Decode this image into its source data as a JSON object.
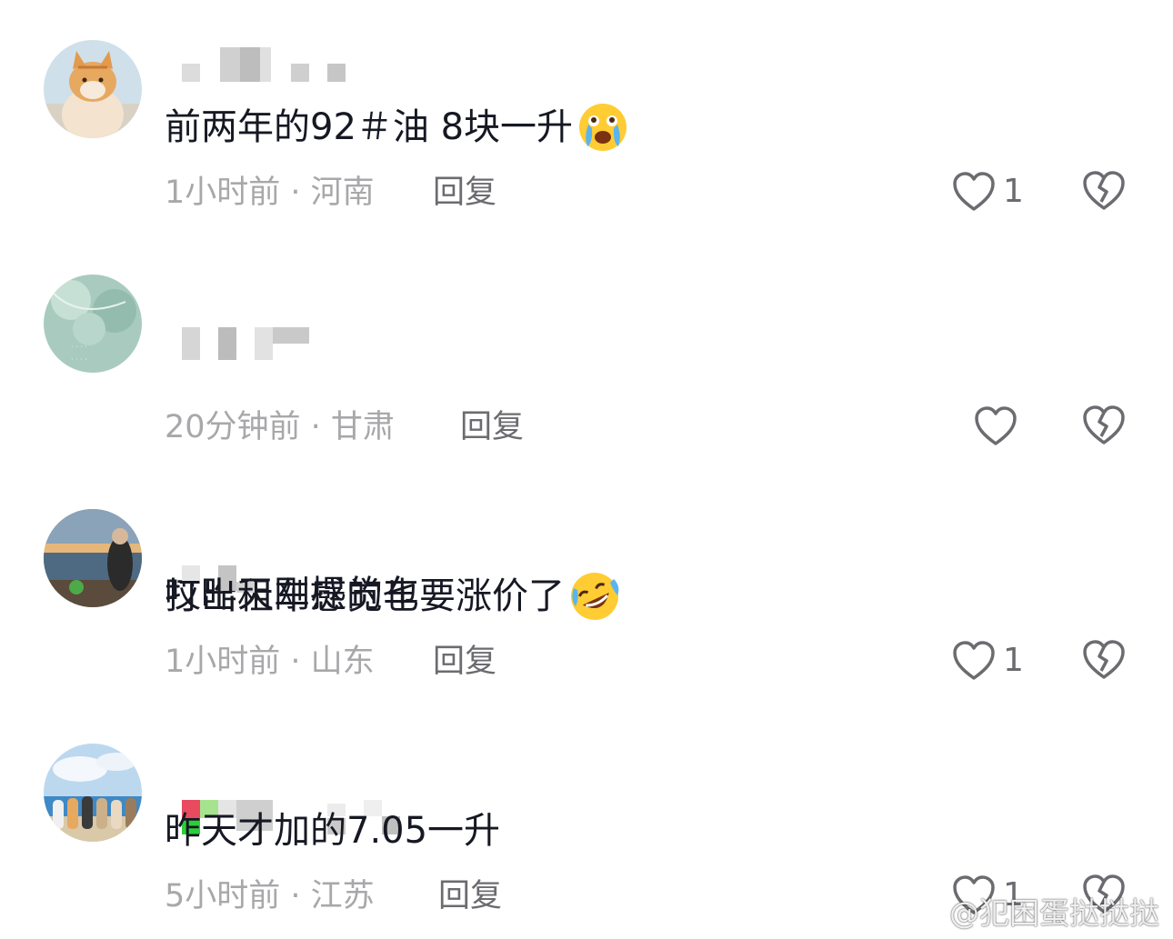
{
  "comments": [
    {
      "text": "前两年的92＃油 8块一升",
      "emoji": "crying-emoji",
      "time": "1小时前",
      "location": "河南",
      "meta": "1小时前 · 河南",
      "reply_label": "回复",
      "likes": "1"
    },
    {
      "text": "哎昨天刚提的车",
      "emoji": "",
      "time": "20分钟前",
      "location": "甘肃",
      "meta": "20分钟前 · 甘肃",
      "reply_label": "回复",
      "likes": ""
    },
    {
      "text": "打出租车感觉也要涨价了",
      "emoji": "rolling-laughing-emoji",
      "time": "1小时前",
      "location": "山东",
      "meta": "1小时前 · 山东",
      "reply_label": "回复",
      "likes": "1"
    },
    {
      "text": "昨天才加的7.05一升",
      "emoji": "",
      "time": "5小时前",
      "location": "江苏",
      "meta": "5小时前 · 江苏",
      "reply_label": "回复",
      "likes": "1"
    }
  ],
  "watermark": {
    "icon": "weibo-logo-icon",
    "text": "@犯困蛋挞挞挞"
  },
  "colors": {
    "text": "#161823",
    "meta": "#a8a8ab",
    "reply": "#6b6b70",
    "icon_stroke": "#6b6b70"
  },
  "icons": {
    "like": "heart-outline-icon",
    "dislike": "broken-heart-icon"
  }
}
